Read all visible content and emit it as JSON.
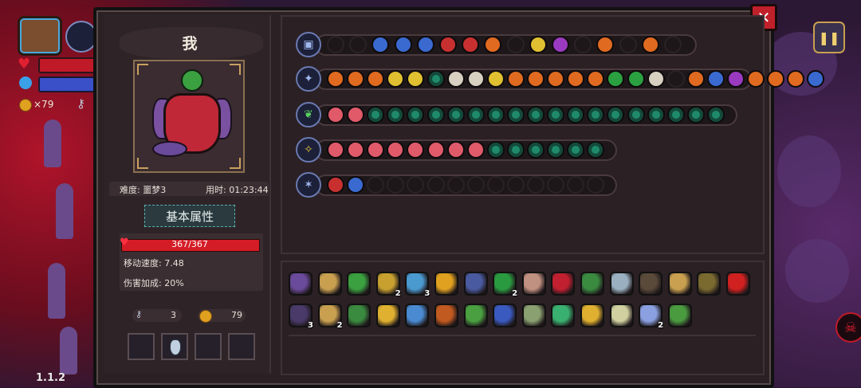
{
  "player": {
    "name": "我"
  },
  "info": {
    "difficulty": "难度: 噩梦3",
    "time": "用时: 01:23:44"
  },
  "tab": {
    "basic_attributes": "基本属性"
  },
  "stats": {
    "hp": "367/367",
    "move_speed": "移动速度: 7.48",
    "damage_bonus": "伤害加成: 20%"
  },
  "resources": {
    "keys": "3",
    "coins": "79"
  },
  "hud": {
    "coins": "×79",
    "version": "1.1.2"
  },
  "colors": {
    "accent": "#c8a050",
    "hp": "#d41c26",
    "mana": "#3a50c8"
  },
  "equipment_rows": [
    {
      "icon": "chest-icon",
      "slots": [
        "empty",
        "empty",
        "blue",
        "blue",
        "blue",
        "red",
        "red",
        "orange",
        "empty",
        "yellow",
        "purple",
        "empty",
        "orange",
        "empty",
        "orange",
        "empty"
      ]
    },
    {
      "icon": "staff-blue-icon",
      "slots": [
        "orange",
        "orange",
        "orange",
        "yellow",
        "yellow",
        "teal",
        "white",
        "white",
        "yellow",
        "orange",
        "orange",
        "orange",
        "orange",
        "orange",
        "green",
        "green",
        "white",
        "empty",
        "orange",
        "blue",
        "purple",
        "orange",
        "orange",
        "orange",
        "blue"
      ]
    },
    {
      "icon": "staff-green-icon",
      "slots": [
        "pink",
        "pink",
        "teal",
        "teal",
        "teal",
        "teal",
        "teal",
        "teal",
        "teal",
        "teal",
        "teal",
        "teal",
        "teal",
        "teal",
        "teal",
        "teal",
        "teal",
        "teal",
        "teal",
        "teal"
      ]
    },
    {
      "icon": "staff-gold-icon",
      "slots": [
        "pink",
        "pink",
        "pink",
        "pink",
        "pink",
        "pink",
        "pink",
        "pink",
        "teal",
        "teal",
        "teal",
        "teal",
        "teal",
        "teal"
      ]
    },
    {
      "icon": "wand-purple-icon",
      "slots": [
        "red",
        "blue",
        "empty",
        "empty",
        "empty",
        "empty",
        "empty",
        "empty",
        "empty",
        "empty",
        "empty",
        "empty",
        "empty",
        "empty"
      ]
    }
  ],
  "inventory": [
    {
      "name": "hood-icon",
      "color": "#6a4a9a",
      "count": ""
    },
    {
      "name": "bone-icon",
      "color": "#c8a050",
      "count": ""
    },
    {
      "name": "sprout-icon",
      "color": "#3aa040",
      "count": ""
    },
    {
      "name": "gem-icon",
      "color": "#c8a030",
      "count": "2"
    },
    {
      "name": "magnifier-icon",
      "color": "#4a9ad0",
      "count": "3"
    },
    {
      "name": "scroll-icon",
      "color": "#e0a020",
      "count": ""
    },
    {
      "name": "crystal-icon",
      "color": "#4a5aa0",
      "count": ""
    },
    {
      "name": "clover-icon",
      "color": "#2a9a40",
      "count": "2"
    },
    {
      "name": "stone-icon",
      "color": "#c09080",
      "count": ""
    },
    {
      "name": "demon-mask-icon",
      "color": "#c02030",
      "count": ""
    },
    {
      "name": "hook-icon",
      "color": "#3a8a40",
      "count": ""
    },
    {
      "name": "compass-icon",
      "color": "#9ab0c0",
      "count": ""
    },
    {
      "name": "beetle-icon",
      "color": "#5a4a3a",
      "count": ""
    },
    {
      "name": "lantern-icon",
      "color": "#c8a050",
      "count": ""
    },
    {
      "name": "cloak-icon",
      "color": "#7a6a30",
      "count": ""
    },
    {
      "name": "red-eye-icon",
      "color": "#d02020",
      "count": ""
    },
    {
      "name": "dark-hood-icon",
      "color": "#4a3a6a",
      "count": "3"
    },
    {
      "name": "twin-bone-icon",
      "color": "#c8a050",
      "count": "2"
    },
    {
      "name": "boot-icon",
      "color": "#3a8a40",
      "count": ""
    },
    {
      "name": "gold-goblet-icon",
      "color": "#e0b030",
      "count": ""
    },
    {
      "name": "blue-gem-icon",
      "color": "#4a8ad0",
      "count": ""
    },
    {
      "name": "spider-web-icon",
      "color": "#c05a20",
      "count": ""
    },
    {
      "name": "syringe-icon",
      "color": "#4aa040",
      "count": ""
    },
    {
      "name": "potion-icon",
      "color": "#3a5ac0",
      "count": ""
    },
    {
      "name": "arrow-icon",
      "color": "#8aa070",
      "count": ""
    },
    {
      "name": "leaf-fan-icon",
      "color": "#3ab070",
      "count": ""
    },
    {
      "name": "bell-icon",
      "color": "#e0b030",
      "count": ""
    },
    {
      "name": "feather-icon",
      "color": "#d0d0a0",
      "count": ""
    },
    {
      "name": "wings-icon",
      "color": "#8aa0e0",
      "count": "2"
    },
    {
      "name": "frog-icon",
      "color": "#4a9a40",
      "count": ""
    }
  ]
}
